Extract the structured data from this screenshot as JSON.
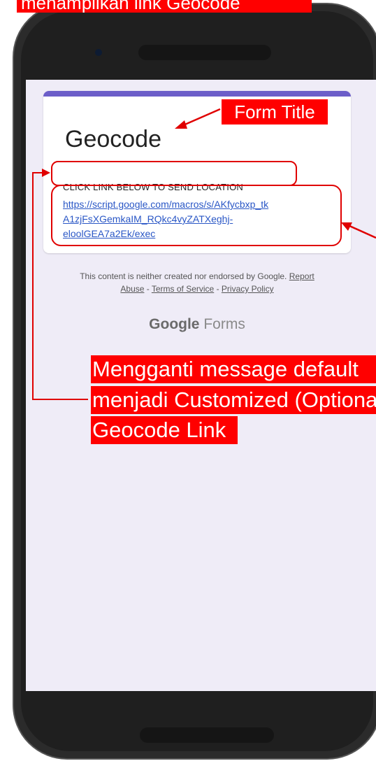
{
  "annotations": {
    "top_label": "menampilkan link Geocode",
    "form_title_label": "Form Title",
    "custom_message_label_line1": "Mengganti message default",
    "custom_message_label_line2": "menjadi  Customized (Optional)",
    "custom_message_label_line3": "Geocode Link"
  },
  "form": {
    "title": "Geocode",
    "description": "CLICK LINK BELOW TO SEND LOCATION",
    "link_line1": "https://script.google.com/macros/s/AKfycbxp_tk",
    "link_line2": "A1zjFsXGemkaIM_RQkc4vyZATXeghj-",
    "link_line3": "eloolGEA7a2Ek/exec"
  },
  "footer": {
    "disclaimer": "This content is neither created nor endorsed by Google.",
    "report": "Report",
    "abuse": "Abuse",
    "sep1": " - ",
    "terms": "Terms of Service",
    "sep2": " - ",
    "privacy": "Privacy Policy",
    "brand_google": "Google",
    "brand_forms": "Forms"
  },
  "colors": {
    "accent": "#6c5ec9",
    "link": "#2a57c6",
    "annotation": "#ff0000",
    "screen_bg": "#efecf7"
  }
}
